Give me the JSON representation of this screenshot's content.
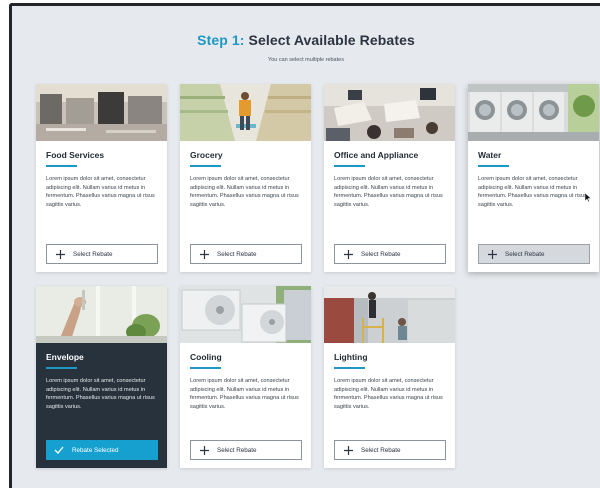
{
  "header": {
    "step_label": "Step 1:",
    "title": "Select Available Rebates",
    "subtitle": "You can select multiple rebates"
  },
  "colors": {
    "accent": "#1f97c4",
    "selected_card": "#28323c",
    "selected_button": "#16a0cf",
    "background": "#e6e9ed"
  },
  "cards": [
    {
      "title": "Food Services",
      "description": "Lorem ipsum dolor sit amet, consectetur adipiscing elit. Nullam varius id metus in fermentum. Phasellus varius magna ut risus sagittis varius.",
      "button_label": "Select Rebate",
      "button_icon": "plus-icon",
      "state": "default"
    },
    {
      "title": "Grocery",
      "description": "Lorem ipsum dolor sit amet, consectetur adipiscing elit. Nullam varius id metus in fermentum. Phasellus varius magna ut risus sagittis varius.",
      "button_label": "Select Rebate",
      "button_icon": "plus-icon",
      "state": "default"
    },
    {
      "title": "Office and Appliance",
      "description": "Lorem ipsum dolor sit amet, consectetur adipiscing elit. Nullam varius id metus in fermentum. Phasellus varius magna ut risus sagittis varius.",
      "button_label": "Select Rebate",
      "button_icon": "plus-icon",
      "state": "default"
    },
    {
      "title": "Water",
      "description": "Lorem ipsum dolor sit amet, consectetur adipiscing elit. Nullam varius id metus in fermentum. Phasellus varius magna ut risus sagittis varius.",
      "button_label": "Select Rebate",
      "button_icon": "plus-icon",
      "state": "hovered"
    },
    {
      "title": "Envelope",
      "description": "Lorem ipsum dolor sit amet, consectetur adipiscing elit. Nullam varius id metus in fermentum. Phasellus varius magna ut risus sagittis varius.",
      "button_label": "Rebate Selected",
      "button_icon": "checkmark-icon",
      "state": "selected"
    },
    {
      "title": "Cooling",
      "description": "Lorem ipsum dolor sit amet, consectetur adipiscing elit. Nullam varius id metus in fermentum. Phasellus varius magna ut risus sagittis varius.",
      "button_label": "Select Rebate",
      "button_icon": "plus-icon",
      "state": "default"
    },
    {
      "title": "Lighting",
      "description": "Lorem ipsum dolor sit amet, consectetur adipiscing elit. Nullam varius id metus in fermentum. Phasellus varius magna ut risus sagittis varius.",
      "button_label": "Select Rebate",
      "button_icon": "plus-icon",
      "state": "default"
    }
  ]
}
